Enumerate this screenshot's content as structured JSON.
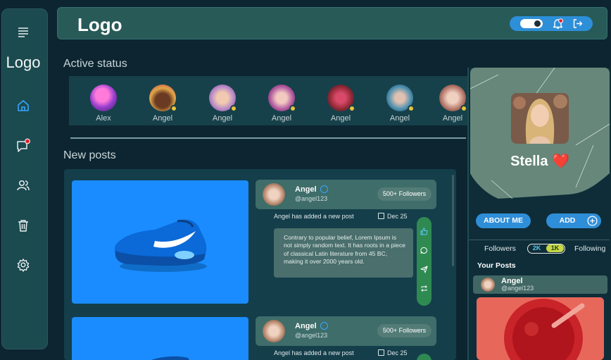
{
  "app": {
    "logo": "Logo",
    "sidebar_logo": "Logo"
  },
  "sidebar": {
    "items": [
      {
        "name": "menu",
        "icon": "menu-icon"
      },
      {
        "name": "home",
        "icon": "home-icon",
        "active": true
      },
      {
        "name": "messages",
        "icon": "message-icon",
        "badge": true
      },
      {
        "name": "friends",
        "icon": "users-icon"
      },
      {
        "name": "trash",
        "icon": "trash-icon"
      },
      {
        "name": "settings",
        "icon": "gear-icon"
      }
    ]
  },
  "header": {
    "icons": [
      "theme-toggle",
      "bell-icon",
      "logout-icon"
    ],
    "toggle_on": true
  },
  "active_status": {
    "title": "Active status",
    "users": [
      {
        "name": "Alex",
        "color": "#9a3fd0",
        "online": false
      },
      {
        "name": "Angel",
        "color": "#e0a64a",
        "online": true
      },
      {
        "name": "Angel",
        "color": "#b989c8",
        "online": true
      },
      {
        "name": "Angel",
        "color": "#b25aa0",
        "online": true
      },
      {
        "name": "Angel",
        "color": "#9a2c3a",
        "online": true
      },
      {
        "name": "Angel",
        "color": "#4a8fae",
        "online": true
      },
      {
        "name": "Angel",
        "color": "#b5776a",
        "online": true
      }
    ]
  },
  "new_posts": {
    "title": "New posts",
    "posts": [
      {
        "author": "Angel",
        "handle": "@angel123",
        "followers": "500+ Followers",
        "activity": "Angel has added a new post",
        "date": "Dec 25",
        "text": "Contrary to popular belief, Lorem Ipsum is not simply random text. It has roots in a piece of classical Latin literature from 45 BC, making it over 2000 years old.",
        "actions": [
          "like-icon",
          "comment-icon",
          "send-icon",
          "repost-icon"
        ]
      },
      {
        "author": "Angel",
        "handle": "@angel123",
        "followers": "500+ Followers",
        "activity": "Angel has added a new post",
        "date": "Dec 25"
      }
    ]
  },
  "profile": {
    "name": "Stella ❤️",
    "about_label": "ABOUT ME",
    "add_label": "ADD",
    "followers_label": "Followers",
    "following_label": "Following",
    "followers_count": "2K",
    "following_count": "1K",
    "your_posts_label": "Your Posts",
    "post_author": "Angel",
    "post_handle": "@angel123"
  },
  "colors": {
    "accent": "#2f8ed8",
    "panel": "#285a58",
    "online_dot": "#e8c33a",
    "action_bar": "#2f8a52"
  }
}
